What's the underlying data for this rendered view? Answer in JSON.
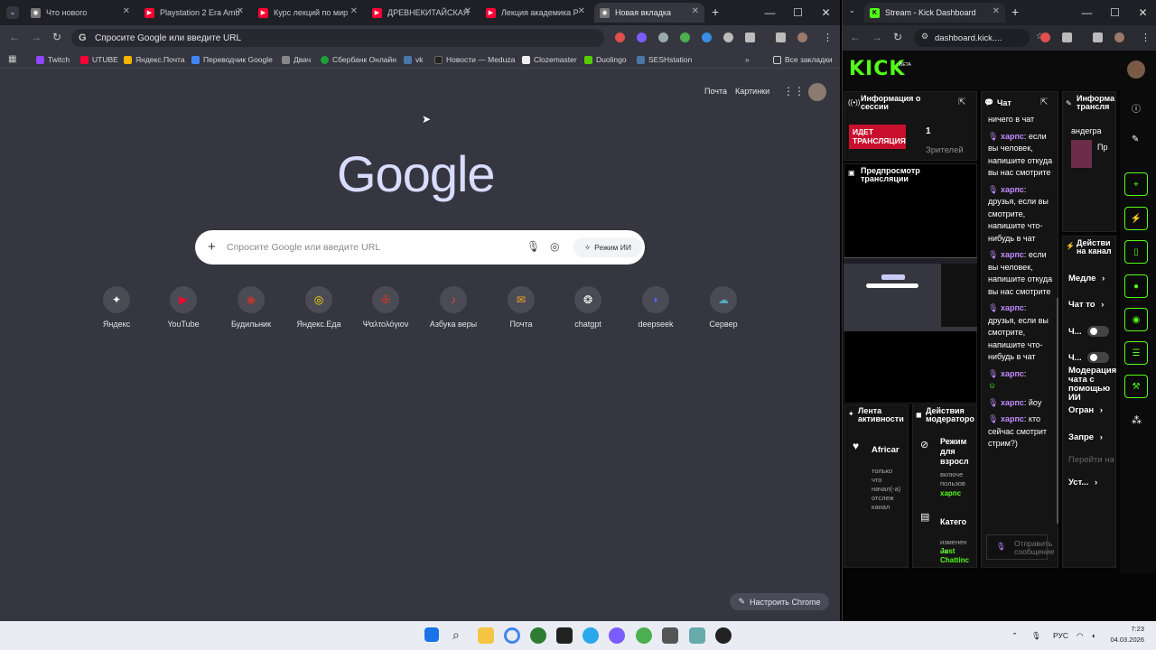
{
  "left_browser": {
    "tabs": [
      {
        "label": "Что нового"
      },
      {
        "label": "Playstation 2 Era Amb"
      },
      {
        "label": "Курс лекций по мир"
      },
      {
        "label": "ДРЕВНЕКИТАЙСКАЯ"
      },
      {
        "label": "Лекция академика Р"
      },
      {
        "label": "Новая вкладка"
      }
    ],
    "omnibox_placeholder": "Спросите Google или введите URL",
    "bookmarks": [
      "Twitch",
      "UTUBE",
      "Яндекс.Почта",
      "Переводчик Google",
      "Двач",
      "Сбербанк Онлайн",
      "vk",
      "Новости — Meduza",
      "Clozemaster",
      "Duolingo",
      "SESHstation"
    ],
    "all_bookmarks": "Все закладки",
    "top_links": {
      "mail": "Почта",
      "images": "Картинки"
    },
    "logo": "Google",
    "search_placeholder": "Спросите Google или введите URL",
    "ai_mode": "Режим ИИ",
    "shortcuts": [
      "Яндекс",
      "YouTube",
      "Будильник",
      "Яндекс.Еда",
      "Ψαλτολόγιον",
      "Азбука веры",
      "Почта",
      "chatgpt",
      "deepseek",
      "Сервер"
    ],
    "customize": "Настроить Chrome"
  },
  "right_browser": {
    "tab_label": "Stream - Kick Dashboard",
    "url": "dashboard.kick....",
    "logo": "KICK",
    "beta": "BETA",
    "session_info": {
      "title": "Информация о сессии",
      "live_badge": "ИДЕТ ТРАНСЛЯЦИЯ",
      "viewers_count": "1",
      "viewers_label": "Зрителей"
    },
    "preview_title": "Предпросмотр трансляции",
    "chat": {
      "title": "Чат",
      "top_text": "ничего в чат",
      "messages": [
        {
          "user": "харпс",
          "text": ": если вы человек, напишите откуда вы нас смотрите"
        },
        {
          "user": "харпс",
          "text": ": друзья, если вы смотрите, напишите что-нибудь в чат"
        },
        {
          "user": "харпс",
          "text": ": если вы человек, напишите откуда вы нас смотрите"
        },
        {
          "user": "харпс",
          "text": ": друзья, если вы смотрите, напишите что-нибудь в чат"
        },
        {
          "user": "харпс",
          "text": ":"
        },
        {
          "user": "харпс",
          "text": ": йоу"
        },
        {
          "user": "харпс",
          "text": ": кто сейчас смотрит стрим?)"
        }
      ],
      "send_placeholder": "Отправить сообщение"
    },
    "info_panel": {
      "title": "Информа трансля",
      "user": "андегра",
      "extra": "Пр"
    },
    "activity": {
      "title": "Лента активности",
      "item_user": "Africar",
      "item_text": "только что начал(-а) отслеж канал"
    },
    "mod_actions": {
      "title": "Действия модераторо",
      "item1_title": "Режим для взросл",
      "item1_text": "включе пользов",
      "item1_user": "харпс",
      "item2_title": "Катего",
      "item2_text": "изменен на",
      "item2_value": "Just Chattinc"
    },
    "channel_actions": {
      "title": "Действи на канал",
      "items": [
        "Медле",
        "Чат то",
        "Ч...",
        "Ч...",
        "Модерация чата с помощью ИИ",
        "Огран",
        "Запре",
        "Перейти на",
        "Уст..."
      ]
    }
  },
  "taskbar": {
    "lang": "РУС",
    "time": "7:23",
    "date": "04.03.2026"
  }
}
